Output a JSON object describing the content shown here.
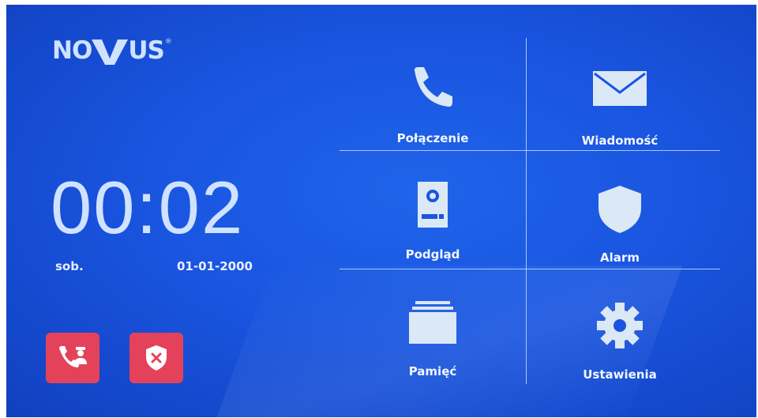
{
  "brand": {
    "name_part1": "NO",
    "name_part2": "US",
    "registered": "®"
  },
  "clock": {
    "time": "00:02",
    "day": "sob.",
    "date": "01-01-2000"
  },
  "quick_actions": [
    {
      "id": "call-security",
      "icon": "phone-guard-icon",
      "color": "#e4425a"
    },
    {
      "id": "alarm-cancel",
      "icon": "shield-x-icon",
      "color": "#e4425a"
    }
  ],
  "menu": {
    "items": [
      {
        "label": "Połączenie",
        "icon": "phone-icon"
      },
      {
        "label": "Wiadomość",
        "icon": "envelope-icon"
      },
      {
        "label": "Podgląd",
        "icon": "door-station-icon"
      },
      {
        "label": "Alarm",
        "icon": "shield-icon"
      },
      {
        "label": "Pamięć",
        "icon": "storage-icon"
      },
      {
        "label": "Ustawienia",
        "icon": "gear-icon"
      }
    ]
  },
  "colors": {
    "background": "#1a55e0",
    "text": "#cfe2ff",
    "accent_button": "#e4425a",
    "icon": "#dbe8f5"
  }
}
